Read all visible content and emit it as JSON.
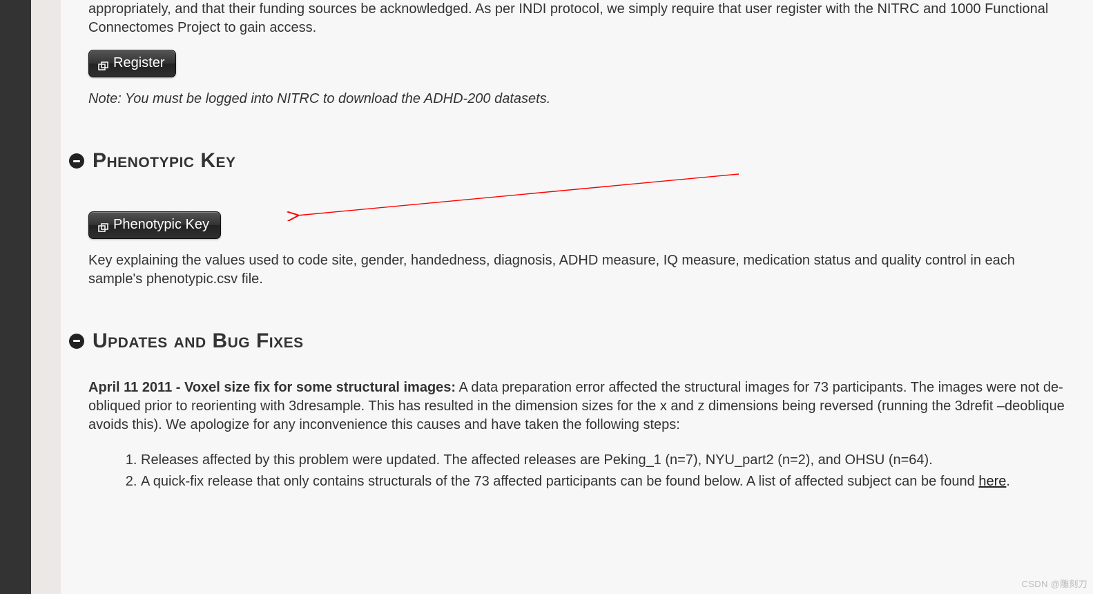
{
  "intro": {
    "text": "appropriately, and that their funding sources be acknowledged. As per INDI protocol, we simply require that user register with the NITRC and 1000 Functional Connectomes Project to gain access.",
    "register_button": "Register",
    "note": "Note: You must be logged into NITRC to download the ADHD-200 datasets."
  },
  "sections": {
    "phenotypic": {
      "heading": "Phenotypic Key",
      "button_label": "Phenotypic Key",
      "description": "Key explaining the values used to code site, gender, handedness, diagnosis, ADHD measure, IQ measure, medication status and quality control in each sample's phenotypic.csv file."
    },
    "updates": {
      "heading": "Updates and Bug Fixes",
      "entry_strong": "April 11 2011 - Voxel size fix for some structural images:",
      "entry_text": " A data preparation error affected the structural images for 73 participants. The images were not de-obliqued prior to reorienting with 3dresample. This has resulted in the dimension sizes for the x and z dimensions being reversed (running the 3drefit –deoblique avoids this). We apologize for any inconvenience this causes and have taken the following steps:",
      "list": [
        "Releases affected by this problem were updated. The affected releases are Peking_1 (n=7), NYU_part2 (n=2), and OHSU (n=64).",
        "A quick-fix release that only contains structurals of the 73 affected participants can be found below. A list of affected subject can be found "
      ],
      "list_link_text": "here"
    }
  },
  "annotation": {
    "arrow_color": "#ff0000"
  },
  "watermark": "CSDN @雕刻刀"
}
